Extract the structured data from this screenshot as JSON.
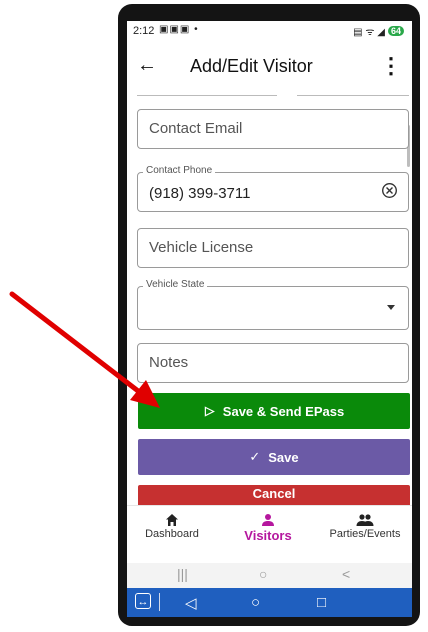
{
  "status_bar": {
    "time": "2:12",
    "battery": "64"
  },
  "app_bar": {
    "title": "Add/Edit Visitor"
  },
  "form": {
    "contact_email": {
      "placeholder": "Contact Email"
    },
    "contact_phone": {
      "label": "Contact Phone",
      "value": "(918) 399-3711"
    },
    "vehicle_license": {
      "placeholder": "Vehicle License"
    },
    "vehicle_state": {
      "label": "Vehicle State",
      "value": ""
    },
    "notes": {
      "placeholder": "Notes"
    }
  },
  "buttons": {
    "save_send": "Save & Send EPass",
    "save": "Save",
    "cancel": "Cancel"
  },
  "bottom_nav": {
    "items": [
      {
        "label": "Dashboard",
        "icon": "home-icon",
        "active": false
      },
      {
        "label": "Visitors",
        "icon": "person-icon",
        "active": true
      },
      {
        "label": "Parties/Events",
        "icon": "group-icon",
        "active": false
      }
    ]
  },
  "colors": {
    "save_send": "#0a8a0a",
    "save": "#6b5aa6",
    "cancel": "#c63030",
    "active_nav": "#b5179e",
    "taskbar": "#1f5fbf",
    "annotation_arrow": "#e00000"
  }
}
